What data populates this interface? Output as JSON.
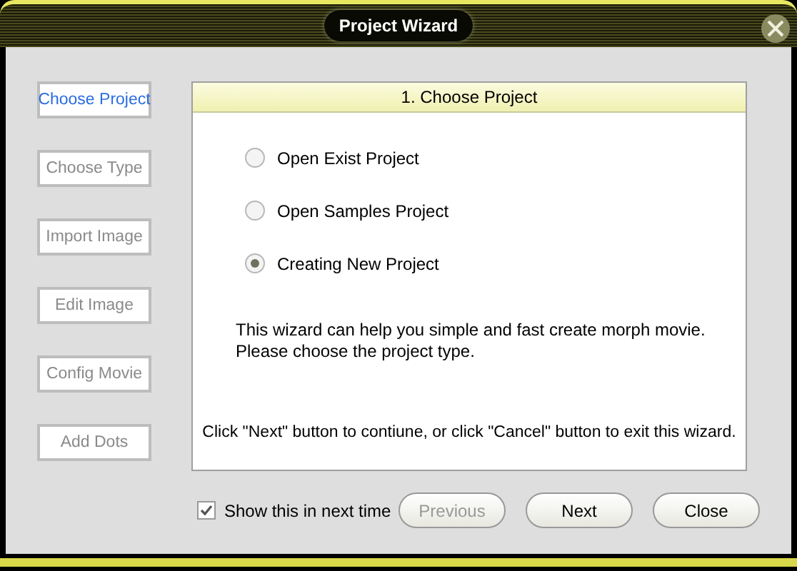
{
  "window": {
    "title": "Project Wizard"
  },
  "steps": [
    {
      "label": "Choose Project",
      "selected": true
    },
    {
      "label": "Choose Type",
      "selected": false
    },
    {
      "label": "Import Image",
      "selected": false
    },
    {
      "label": "Edit Image",
      "selected": false
    },
    {
      "label": "Config Movie",
      "selected": false
    },
    {
      "label": "Add Dots",
      "selected": false
    }
  ],
  "panel": {
    "title": "1. Choose Project",
    "options": [
      {
        "label": "Open Exist Project",
        "selected": false
      },
      {
        "label": "Open Samples Project",
        "selected": false
      },
      {
        "label": "Creating New Project",
        "selected": true
      }
    ],
    "description": [
      "This wizard can help you simple and fast create morph movie.",
      "Please choose the project type."
    ],
    "note": "Click \"Next\" button to contiune, or click \"Cancel\" button to exit this wizard."
  },
  "show_next_time": {
    "label": "Show this in next time",
    "checked": true
  },
  "buttons": [
    {
      "label": "Previous",
      "disabled": true
    },
    {
      "label": "Next",
      "disabled": false
    },
    {
      "label": "Close",
      "disabled": false
    }
  ]
}
